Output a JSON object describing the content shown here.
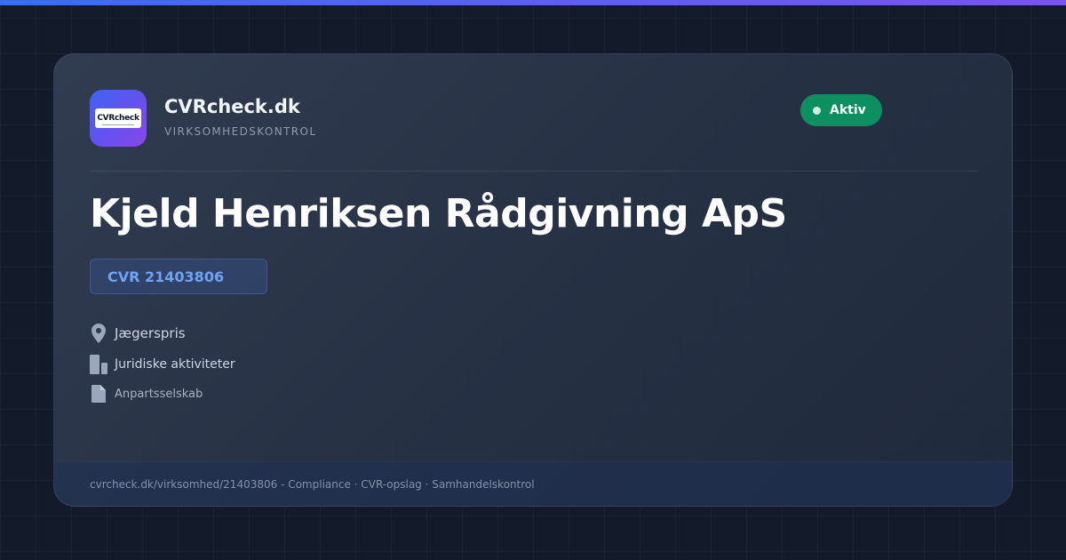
{
  "brand": {
    "logo_text": "CVRcheck",
    "name": "CVRcheck.dk",
    "subtitle": "VIRKSOMHEDSKONTROL"
  },
  "status": {
    "label": "Aktiv",
    "color": "#0e8f62"
  },
  "company": {
    "name": "Kjeld Henriksen Rådgivning ApS",
    "cvr": "CVR 21403806",
    "location": "Jægerspris",
    "industry": "Juridiske aktiviteter",
    "company_type": "Anpartsselskab"
  },
  "icons": {
    "location": "map-pin-icon",
    "industry": "building-icon",
    "company_type": "document-icon"
  },
  "footer": {
    "text": "cvrcheck.dk/virksomhed/21403806 - Compliance · CVR-opslag · Samhandelskontrol"
  },
  "colors": {
    "accent": "#3b6cf0",
    "cvr_text": "#6ea3f5",
    "background": "#131b2b"
  }
}
